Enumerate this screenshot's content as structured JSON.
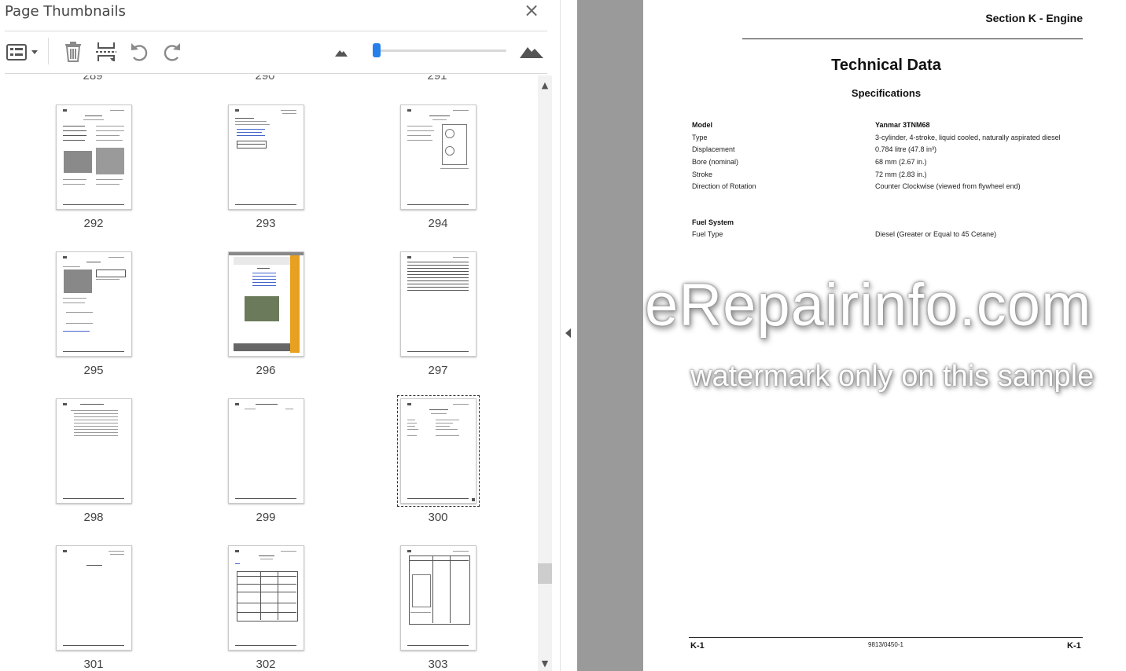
{
  "panel": {
    "title": "Page Thumbnails",
    "close_icon": "×",
    "tools": {
      "options_icon": "options-menu-icon",
      "delete_icon": "trash-icon",
      "insert_icon": "insert-pages-icon",
      "undo_icon": "rotate-counterclockwise-icon",
      "redo_icon": "rotate-clockwise-icon",
      "zoom_out_icon": "small-mountain-icon",
      "zoom_in_icon": "large-mountain-icon"
    },
    "thumbnail_size_slider": 0.02,
    "partial_row": [
      "289",
      "290",
      "291"
    ],
    "thumbnails": [
      {
        "label": "292"
      },
      {
        "label": "293"
      },
      {
        "label": "294"
      },
      {
        "label": "295"
      },
      {
        "label": "296"
      },
      {
        "label": "297"
      },
      {
        "label": "298"
      },
      {
        "label": "299"
      },
      {
        "label": "300",
        "selected": true
      },
      {
        "label": "301"
      },
      {
        "label": "302"
      },
      {
        "label": "303"
      }
    ],
    "scroll_up_icon": "▲",
    "scroll_down_icon": "▼",
    "scroll_position": 0.87
  },
  "document": {
    "section_title": "Section K - Engine",
    "heading": "Technical Data",
    "subheading": "Specifications",
    "specs": [
      {
        "label": "Model",
        "value": "Yanmar 3TNM68",
        "bold": true
      },
      {
        "label": "Type",
        "value": "3-cylinder, 4-stroke, liquid cooled, naturally aspirated diesel"
      },
      {
        "label": "Displacement",
        "value": "0.784 litre (47.8 in³)"
      },
      {
        "label": "Bore (nominal)",
        "value": "68 mm (2.67 in.)"
      },
      {
        "label": "Stroke",
        "value": "72 mm (2.83 in.)"
      },
      {
        "label": "Direction of Rotation",
        "value": "Counter Clockwise (viewed from flywheel end)"
      }
    ],
    "fuel_heading": "Fuel System",
    "fuel_specs": [
      {
        "label": "Fuel Type",
        "value": "Diesel (Greater or Equal to 45 Cetane)"
      }
    ],
    "watermark_main": "eRepairinfo.com",
    "watermark_sub": "watermark only on this sample",
    "footer": {
      "left": "K-1",
      "center": "9813/0450-1",
      "right": "K-1"
    }
  },
  "colors": {
    "accent": "#2680eb",
    "doc_background": "#9a9a9a",
    "thumb_orange": "#e8a020"
  }
}
